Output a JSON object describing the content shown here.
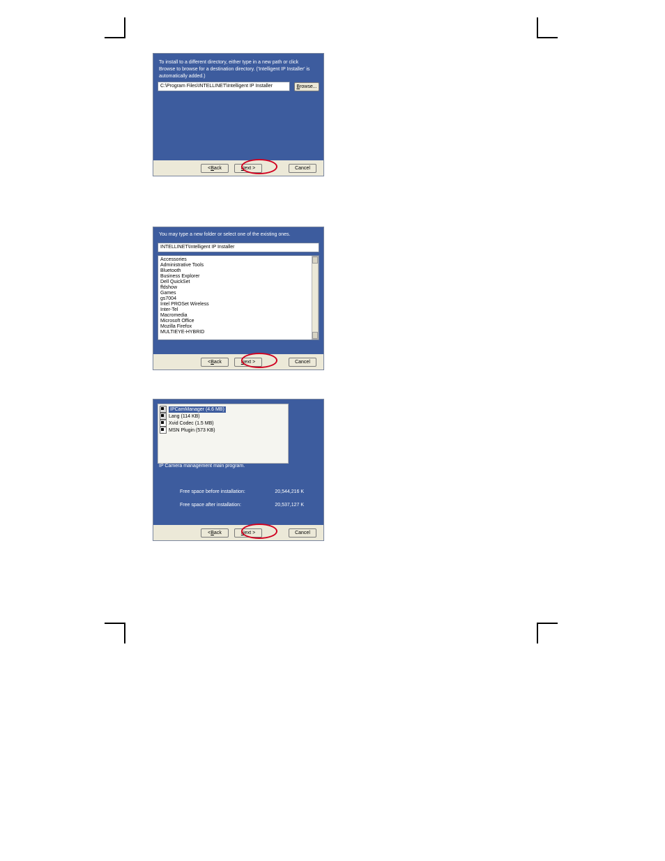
{
  "buttons": {
    "back": "< Back",
    "next": "Next >",
    "cancel": "Cancel",
    "browse": "Browse..."
  },
  "d1": {
    "instr": "To install to a different directory, either type in a new path or click Browse to browse for a destination directory. ('Intelligent IP Installer' is automatically added.)",
    "path": "C:\\Program Files\\INTELLINET\\Intelligent IP Installer"
  },
  "d2": {
    "instr": "You may type a new folder or select one of the existing ones.",
    "folder": "INTELLINET\\Intelligent IP Installer",
    "items": [
      "Accessories",
      "Administrative Tools",
      "Bluetooth",
      "Business Explorer",
      "Dell QuickSet",
      "ffdshow",
      "Games",
      "gs7004",
      "Intel PROSet Wireless",
      "Inter-Tel",
      "Macromedia",
      "Microsoft Office",
      "Mozilla Firefox",
      "MULTIEYE-HYBRID"
    ]
  },
  "d3": {
    "components": [
      {
        "label": "IPCamManager (4.6 MB)",
        "checked": true,
        "disabled": true,
        "selected": true
      },
      {
        "label": "Lang (114 KB)",
        "checked": true,
        "disabled": true,
        "selected": false
      },
      {
        "label": "Xvid Codec (1.5 MB)",
        "checked": true,
        "disabled": false,
        "selected": false
      },
      {
        "label": "MSN Plugin (573 KB)",
        "checked": true,
        "disabled": false,
        "selected": false
      }
    ],
    "desc": "IP Camera management main program.",
    "free_before_label": "Free space before installation:",
    "free_before_value": "20,544,216 K",
    "free_after_label": "Free space after installation:",
    "free_after_value": "20,537,127 K"
  }
}
